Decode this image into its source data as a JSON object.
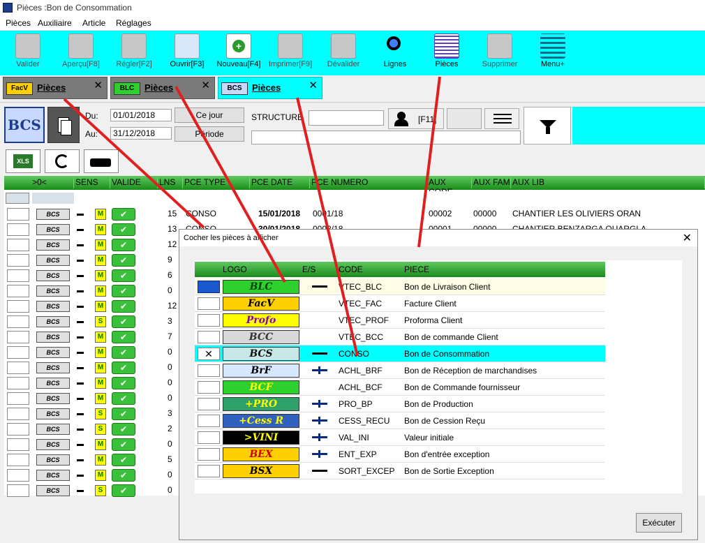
{
  "window": {
    "title": "Pièces :Bon de Consommation"
  },
  "menu": [
    "Pièces",
    "Auxiliaire",
    "Article",
    "Réglages"
  ],
  "toolbar": [
    {
      "label": "Valider",
      "icon": "validate-icon",
      "enabled": false
    },
    {
      "label": "Aperçu[F8]",
      "icon": "preview-icon",
      "enabled": false
    },
    {
      "label": "Régler[F2]",
      "icon": "settle-icon",
      "enabled": false
    },
    {
      "label": "Ouvrir[F3]",
      "icon": "open-icon",
      "enabled": true
    },
    {
      "label": "Nouveau[F4]",
      "icon": "new-icon",
      "enabled": true
    },
    {
      "label": "Imprimer[F9]",
      "icon": "print-icon",
      "enabled": false
    },
    {
      "label": "Dévalider",
      "icon": "unvalidate-icon",
      "enabled": false
    },
    {
      "label": "Lignes",
      "icon": "search-icon",
      "enabled": true
    },
    {
      "label": "Pièces",
      "icon": "grid-icon",
      "enabled": true
    },
    {
      "label": "Supprimer",
      "icon": "delete-icon",
      "enabled": false
    },
    {
      "label": "Menu+",
      "icon": "menu-icon",
      "enabled": true
    }
  ],
  "tabs": [
    {
      "logo": "FacV",
      "label": "Pièces",
      "close": "✕"
    },
    {
      "logo": "BLC",
      "label": "Pièces",
      "close": "✕"
    },
    {
      "logo": "BCS",
      "label": "Pièces",
      "close": "✕"
    }
  ],
  "filters": {
    "big_logo": "BCS",
    "du_label": "Du:",
    "du_value": "01/01/2018",
    "au_label": "Au:",
    "au_value": "31/12/2018",
    "ce_jour": "Ce jour",
    "periode": "Période",
    "structure_label": "STRUCTURE",
    "f11": "[F11]"
  },
  "grid": {
    "headers": [
      ">0<",
      "SENS",
      "VALIDE",
      "LNS",
      "PCE TYPE",
      "PCE DATE",
      "PCE NUMERO",
      "AUX CODE",
      "AUX FAM",
      "AUX LIB"
    ],
    "rows": [
      {
        "lns": "15",
        "type": "CONSO",
        "date": "15/01/2018",
        "num": "0001/18",
        "code": "00002",
        "fam": "00000",
        "lib": "CHANTIER LES OLIVIERS ORAN",
        "m": "M"
      },
      {
        "lns": "13",
        "type": "CONSO",
        "date": "30/01/2018",
        "num": "0002/18",
        "code": "00001",
        "fam": "00000",
        "lib": "CHANTIER BENZARGA OUARGLA",
        "m": "M"
      },
      {
        "lns": "12",
        "m": "M"
      },
      {
        "lns": "9",
        "m": "M"
      },
      {
        "lns": "6",
        "m": "M"
      },
      {
        "lns": "0",
        "m": "M"
      },
      {
        "lns": "12",
        "m": "M"
      },
      {
        "lns": "3",
        "m": "S"
      },
      {
        "lns": "7",
        "m": "M"
      },
      {
        "lns": "0",
        "m": "M"
      },
      {
        "lns": "0",
        "m": "M"
      },
      {
        "lns": "0",
        "m": "M"
      },
      {
        "lns": "0",
        "m": "M"
      },
      {
        "lns": "3",
        "m": "S"
      },
      {
        "lns": "2",
        "m": "S"
      },
      {
        "lns": "0",
        "m": "M"
      },
      {
        "lns": "5",
        "m": "M"
      },
      {
        "lns": "0",
        "m": "M"
      },
      {
        "lns": "0",
        "m": "S"
      }
    ]
  },
  "dialog": {
    "title": "Cocher les pièces à afficher",
    "close": "✕",
    "headers": [
      "LOGO",
      "E/S",
      "CODE",
      "PIECE"
    ],
    "rows": [
      {
        "logo": "BLC",
        "logo_bg": "#2ed02e",
        "logo_fg": "#004000",
        "es": "out",
        "code": "VTEC_BLC",
        "piece": "Bon de Livraison Client",
        "checked": "blue"
      },
      {
        "logo": "FacV",
        "logo_bg": "#ffd000",
        "logo_fg": "#000000",
        "es": "",
        "code": "VTEC_FAC",
        "piece": "Facture Client",
        "checked": "no"
      },
      {
        "logo": "Profo",
        "logo_bg": "#ffff00",
        "logo_fg": "#8a00c0",
        "es": "",
        "code": "VTEC_PROF",
        "piece": "Proforma Client",
        "checked": "no"
      },
      {
        "logo": "BCC",
        "logo_bg": "#d8d8d8",
        "logo_fg": "#333333",
        "es": "",
        "code": "VTEC_BCC",
        "piece": "Bon de commande Client",
        "checked": "no"
      },
      {
        "logo": "BCS",
        "logo_bg": "#c8e8e8",
        "logo_fg": "#111111",
        "es": "out",
        "code": "CONSO",
        "piece": "Bon de Consommation",
        "checked": "x"
      },
      {
        "logo": "BrF",
        "logo_bg": "#d8e8ff",
        "logo_fg": "#000000",
        "es": "in",
        "code": "ACHL_BRF",
        "piece": "Bon de Réception de marchandises",
        "checked": "no"
      },
      {
        "logo": "BCF",
        "logo_bg": "#2ed02e",
        "logo_fg": "#ffff00",
        "es": "",
        "code": "ACHL_BCF",
        "piece": "Bon de Commande fournisseur",
        "checked": "no"
      },
      {
        "logo": "+PRO",
        "logo_bg": "#2ea06a",
        "logo_fg": "#ffff00",
        "es": "in",
        "code": "PRO_BP",
        "piece": "Bon de Production",
        "checked": "no"
      },
      {
        "logo": "+Cess R",
        "logo_bg": "#3060c0",
        "logo_fg": "#ffff00",
        "es": "in",
        "code": "CESS_RECU",
        "piece": "Bon de Cession Reçu",
        "checked": "no"
      },
      {
        "logo": ">VINI",
        "logo_bg": "#000000",
        "logo_fg": "#ffff00",
        "es": "in",
        "code": "VAL_INI",
        "piece": "Valeur initiale",
        "checked": "no"
      },
      {
        "logo": "BEX",
        "logo_bg": "#ffd000",
        "logo_fg": "#d00000",
        "es": "in",
        "code": "ENT_EXP",
        "piece": "Bon d'entrée exception",
        "checked": "no"
      },
      {
        "logo": "BSX",
        "logo_bg": "#ffd000",
        "logo_fg": "#000000",
        "es": "out",
        "code": "SORT_EXCEP",
        "piece": "Bon de Sortie Exception",
        "checked": "no"
      }
    ],
    "exec": "Exécuter"
  }
}
